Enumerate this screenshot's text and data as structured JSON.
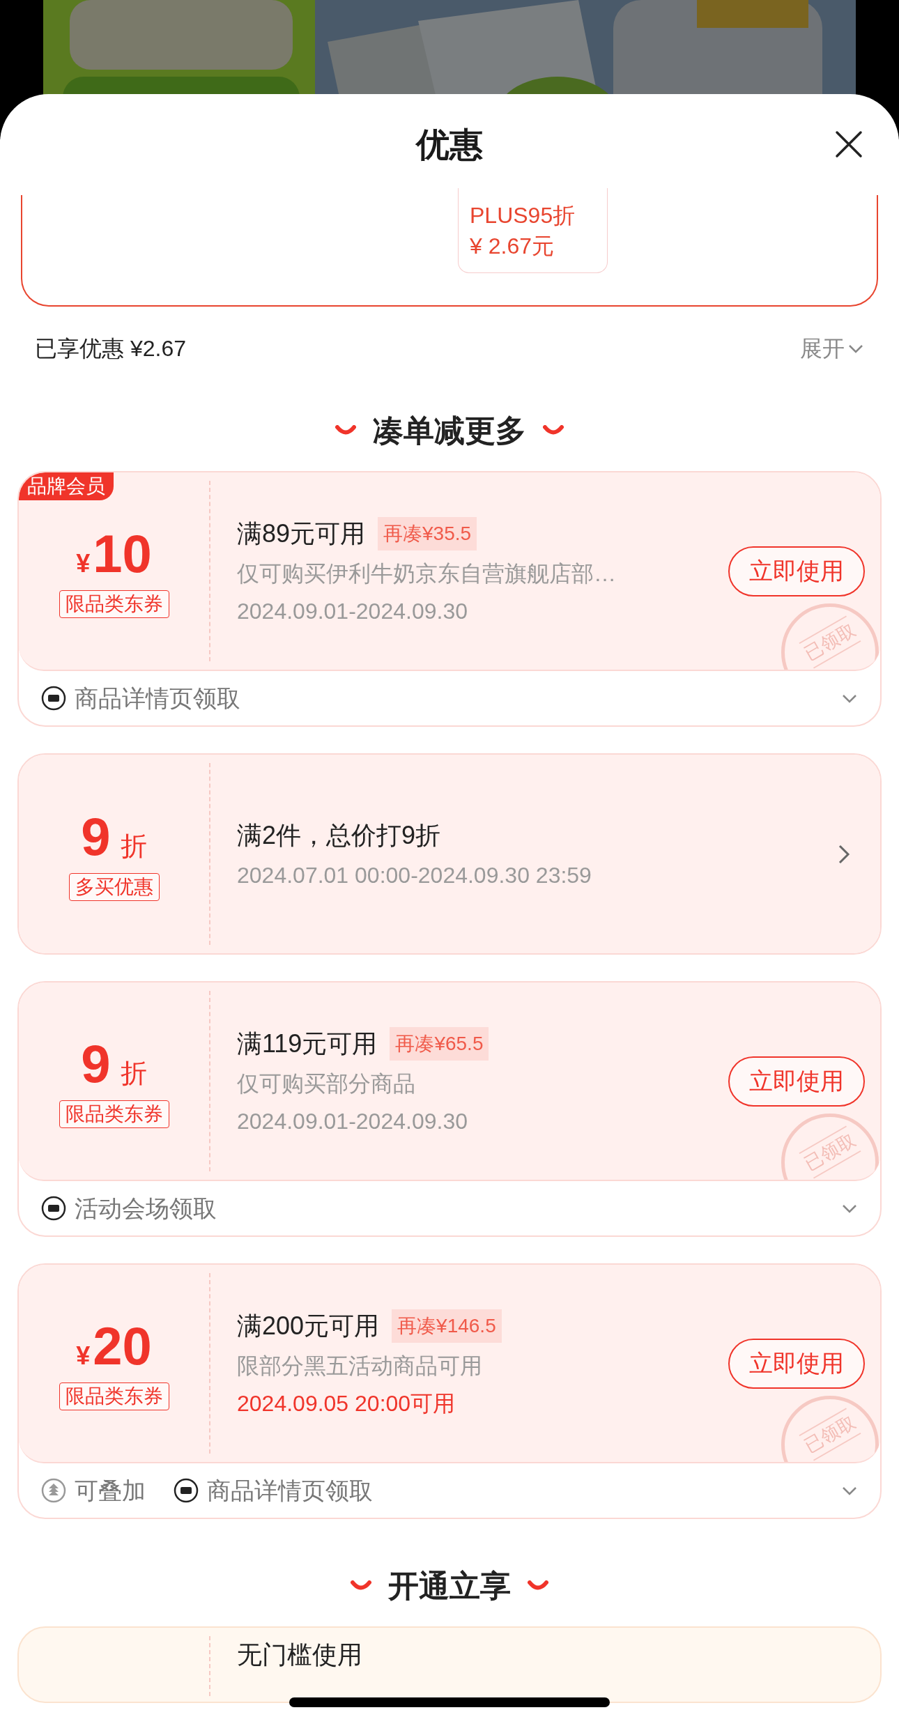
{
  "sheet": {
    "title": "优惠"
  },
  "top_offer": {
    "line_1": "PLUS95折",
    "line_2": "¥ 2.67元"
  },
  "summary": {
    "label": "已享优惠 ¥2.67",
    "toggle": "展开"
  },
  "sections": [
    {
      "title": "凑单减更多",
      "coupons": [
        {
          "badge": "品牌会员",
          "prefix": "¥",
          "value": "10",
          "tag": "限品类东券",
          "title": "满89元可用",
          "gap": "再凑¥35.5",
          "desc": "仅可购买伊利牛奶京东自营旗舰店部…",
          "date": "2024.09.01-2024.09.30",
          "date_highlight": false,
          "action": "立即使用",
          "stamp": "已领取",
          "footer": [
            {
              "kind": "ticket",
              "label": "商品详情页领取"
            }
          ]
        },
        {
          "value": "9",
          "suffix": "折",
          "tag": "多买优惠",
          "title": "满2件，总价打9折",
          "date": "2024.07.01 00:00-2024.09.30 23:59",
          "date_highlight": false
        },
        {
          "value": "9",
          "suffix": "折",
          "tag": "限品类东券",
          "title": "满119元可用",
          "gap": "再凑¥65.5",
          "desc": "仅可购买部分商品",
          "date": "2024.09.01-2024.09.30",
          "date_highlight": false,
          "action": "立即使用",
          "stamp": "已领取",
          "footer": [
            {
              "kind": "ticket",
              "label": "活动会场领取"
            }
          ]
        },
        {
          "prefix": "¥",
          "value": "20",
          "tag": "限品类东券",
          "title": "满200元可用",
          "gap": "再凑¥146.5",
          "desc": "限部分黑五活动商品可用",
          "date": "2024.09.05 20:00可用",
          "date_highlight": true,
          "action": "立即使用",
          "stamp": "已领取",
          "footer": [
            {
              "kind": "stack",
              "label": "可叠加"
            },
            {
              "kind": "ticket",
              "label": "商品详情页领取"
            }
          ]
        }
      ]
    },
    {
      "title": "开通立享",
      "coupons": [
        {
          "kind": "plus",
          "title": "无门槛使用"
        }
      ]
    }
  ]
}
